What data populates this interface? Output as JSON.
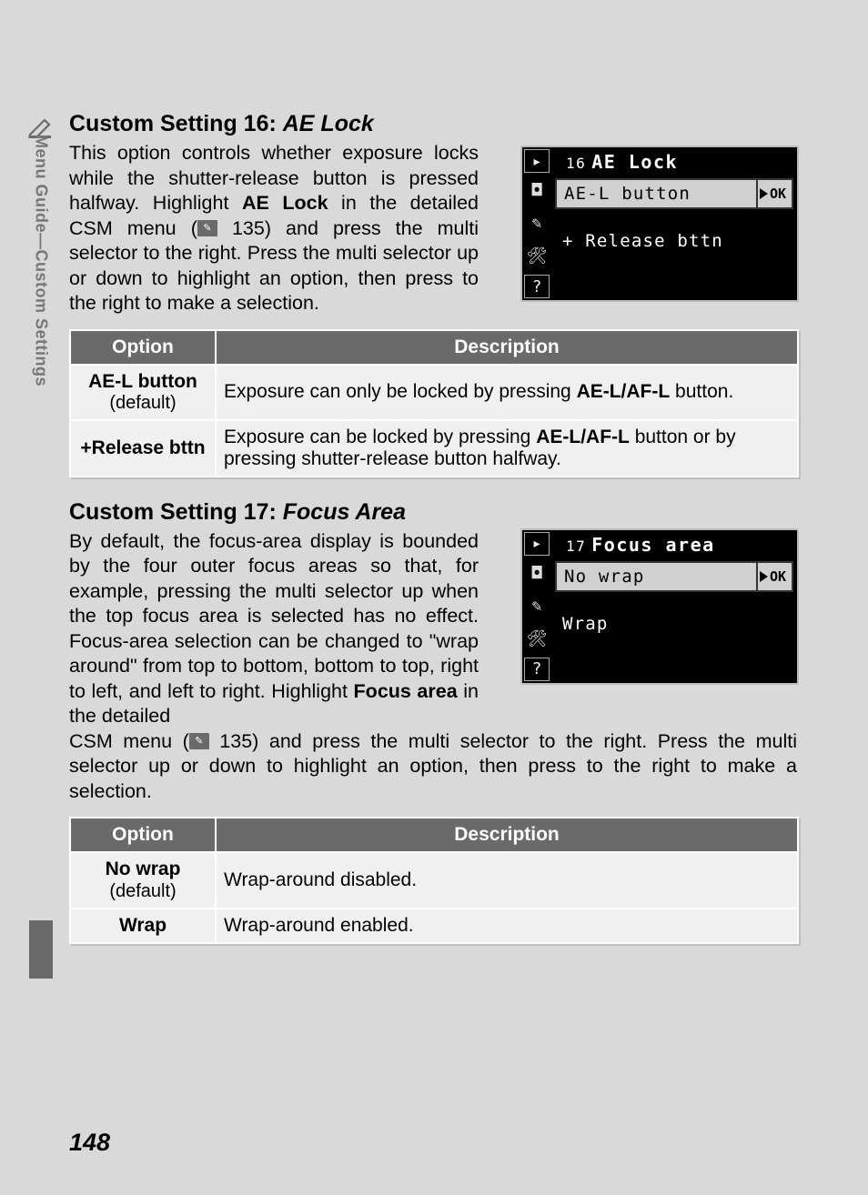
{
  "sideTab": "Menu Guide—Custom Settings",
  "pageNumber": "148",
  "pageRef": "135",
  "section16": {
    "headingPrefix": "Custom Setting 16: ",
    "headingItalic": "AE Lock",
    "para1a": "This option controls whether exposure locks while the shutter-release button is pressed halfway. Highlight ",
    "para1bold": "AE Lock",
    "para1b": " in the detailed CSM menu (",
    "para1c": " 135) and press the multi selector to the right. Press the multi selector up or down to highlight an option, then press to the right to make a selection.",
    "lcd": {
      "num": "16",
      "title": "AE Lock",
      "opt1": "AE-L button",
      "opt2": "+ Release bttn",
      "ok": "OK"
    },
    "table": {
      "headOption": "Option",
      "headDesc": "Description",
      "rows": [
        {
          "optStrong": "AE-L button",
          "optDef": "(default)",
          "descPre": "Exposure can only be locked by pressing ",
          "descBold": "AE-L/AF-L",
          "descPost": " button."
        },
        {
          "optStrong": "+Release bttn",
          "optDef": "",
          "descPre": "Exposure can be locked by pressing ",
          "descBold": "AE-L/AF-L",
          "descPost": " button or by pressing shutter-release button halfway."
        }
      ]
    }
  },
  "section17": {
    "headingPrefix": "Custom Setting 17: ",
    "headingItalic": "Focus Area",
    "para1a": "By default, the focus-area display is bounded by the four outer focus areas so that, for example, pressing the multi selector up when the top focus area is selected has no effect.  Focus-area selection can be changed to \"wrap around\" from top to bottom, bottom to top, right to left, and left to right.  Highlight ",
    "para1bold": "Focus area",
    "para1b": " in the detailed",
    "para2a": "CSM menu (",
    "para2b": " 135) and press the multi selector to the right.  Press the multi selector up or down to highlight an option, then press to the right to make a selection.",
    "lcd": {
      "num": "17",
      "title": "Focus area",
      "opt1": "No wrap",
      "opt2": "Wrap",
      "ok": "OK"
    },
    "table": {
      "headOption": "Option",
      "headDesc": "Description",
      "rows": [
        {
          "optStrong": "No wrap",
          "optDef": "(default)",
          "desc": "Wrap-around disabled."
        },
        {
          "optStrong": "Wrap",
          "optDef": "",
          "desc": "Wrap-around enabled."
        }
      ]
    }
  }
}
